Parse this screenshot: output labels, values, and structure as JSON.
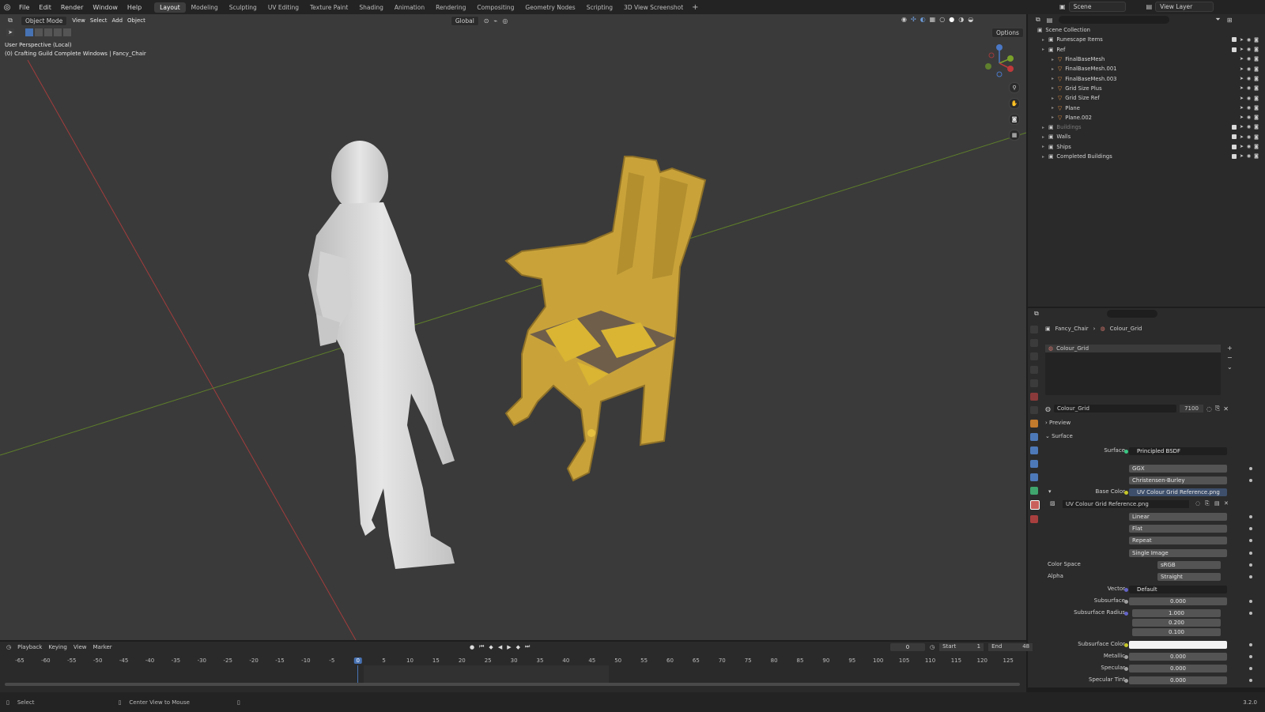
{
  "menu": {
    "items": [
      "File",
      "Edit",
      "Render",
      "Window",
      "Help"
    ]
  },
  "workspaces": [
    "Layout",
    "Modeling",
    "Sculpting",
    "UV Editing",
    "Texture Paint",
    "Shading",
    "Animation",
    "Rendering",
    "Compositing",
    "Geometry Nodes",
    "Scripting",
    "3D View Screenshot"
  ],
  "scene": {
    "name": "Scene",
    "view_layer": "View Layer"
  },
  "viewport": {
    "mode": "Object Mode",
    "menus": [
      "View",
      "Select",
      "Add",
      "Object"
    ],
    "transform_orientation": "Global",
    "options_label": "Options",
    "info_line1": "User Perspective (Local)",
    "info_line2": "(0) Crafting Guild Complete Windows | Fancy_Chair"
  },
  "outliner": {
    "root": "Scene Collection",
    "rows": [
      {
        "label": "Runescape Items",
        "indent": 1,
        "type": "collection"
      },
      {
        "label": "Ref",
        "indent": 1,
        "type": "collection"
      },
      {
        "label": "FinalBaseMesh",
        "indent": 2,
        "type": "object"
      },
      {
        "label": "FinalBaseMesh.001",
        "indent": 2,
        "type": "object"
      },
      {
        "label": "FinalBaseMesh.003",
        "indent": 2,
        "type": "object"
      },
      {
        "label": "Grid Size Plus",
        "indent": 2,
        "type": "object"
      },
      {
        "label": "Grid Size Ref",
        "indent": 2,
        "type": "object"
      },
      {
        "label": "Plane",
        "indent": 2,
        "type": "object"
      },
      {
        "label": "Plane.002",
        "indent": 2,
        "type": "object"
      },
      {
        "label": "Buildings",
        "indent": 1,
        "type": "collection-dim"
      },
      {
        "label": "Walls",
        "indent": 1,
        "type": "collection"
      },
      {
        "label": "Ships",
        "indent": 1,
        "type": "collection"
      },
      {
        "label": "Completed Buildings",
        "indent": 1,
        "type": "collection"
      }
    ]
  },
  "properties": {
    "breadcrumb_object": "Fancy_Chair",
    "breadcrumb_material": "Colour_Grid",
    "slot_name": "Colour_Grid",
    "material_name": "Colour_Grid",
    "user_count": "7100",
    "preview_label": "Preview",
    "surface_label": "Surface",
    "surface_field_label": "Surface",
    "surface_shader": "Principled BSDF",
    "distribution": "GGX",
    "subsurface_method": "Christensen-Burley",
    "base_color_label": "Base Color",
    "base_color_value": "UV Colour Grid Reference.png",
    "image_name": "UV Colour Grid Reference.png",
    "interpolation": "Linear",
    "projection": "Flat",
    "extension": "Repeat",
    "source": "Single Image",
    "color_space_label": "Color Space",
    "color_space": "sRGB",
    "alpha_label": "Alpha",
    "alpha": "Straight",
    "vector_label": "Vector",
    "vector": "Default",
    "subsurface_label": "Subsurface",
    "subsurface": "0.000",
    "subsurface_radius_label": "Subsurface Radius",
    "subsurface_radius": [
      "1.000",
      "0.200",
      "0.100"
    ],
    "subsurface_color_label": "Subsurface Color",
    "metallic_label": "Metallic",
    "metallic": "0.000",
    "specular_label": "Specular",
    "specular": "0.000",
    "specular_tint_label": "Specular Tint",
    "specular_tint": "0.000"
  },
  "timeline": {
    "menus": [
      "Playback",
      "Keying",
      "View",
      "Marker"
    ],
    "current_frame": "0",
    "start_label": "Start",
    "start": "1",
    "end_label": "End",
    "end": "48",
    "ticks": [
      "-65",
      "-60",
      "-55",
      "-50",
      "-45",
      "-40",
      "-35",
      "-30",
      "-25",
      "-20",
      "-15",
      "-10",
      "-5",
      "0",
      "5",
      "10",
      "15",
      "20",
      "25",
      "30",
      "35",
      "40",
      "45",
      "50",
      "55",
      "60",
      "65",
      "70",
      "75",
      "80",
      "85",
      "90",
      "95",
      "100",
      "105",
      "110",
      "115",
      "120",
      "125"
    ]
  },
  "status": {
    "select": "Select",
    "center_view": "Center View to Mouse",
    "version": "3.2.0"
  },
  "colors": {
    "accent": "#4772b3",
    "chair": "#c9a33a",
    "chair_dark": "#8f7127",
    "figure": "#dcdcdc",
    "grid_x": "#b03a3a",
    "grid_y": "#6a8a2a"
  }
}
